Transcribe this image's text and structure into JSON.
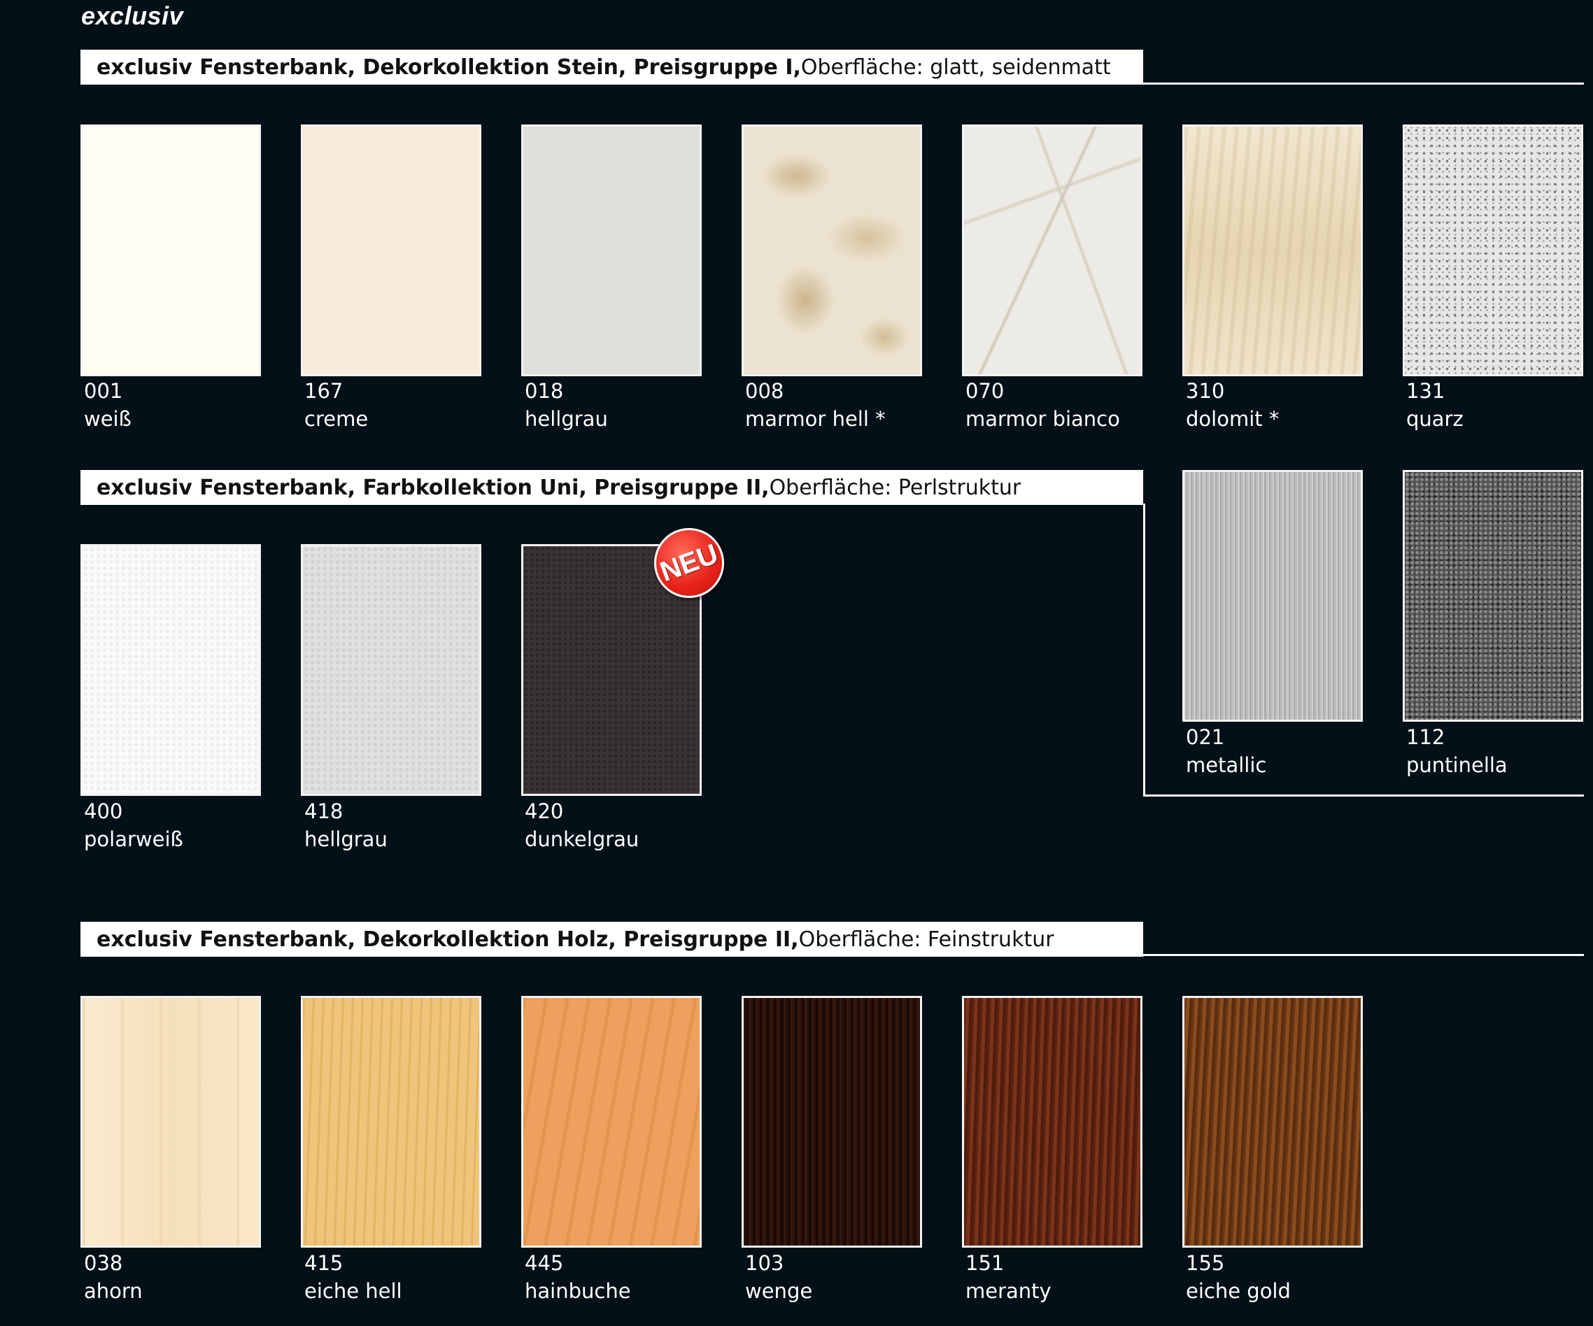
{
  "logo": "exclusiv",
  "sections": [
    {
      "header_bold": "exclusiv Fensterbank, Dekorkollektion Stein, Preisgruppe I,",
      "header_regular": " Oberfläche: glatt, seidenmatt",
      "items": [
        {
          "code": "001",
          "name": "weiß"
        },
        {
          "code": "167",
          "name": "creme"
        },
        {
          "code": "018",
          "name": "hellgrau"
        },
        {
          "code": "008",
          "name": "marmor hell *"
        },
        {
          "code": "070",
          "name": "marmor bianco"
        },
        {
          "code": "310",
          "name": "dolomit *"
        },
        {
          "code": "131",
          "name": "quarz"
        }
      ]
    },
    {
      "header_bold": "exclusiv Fensterbank, Farbkollektion Uni, Preisgruppe II,",
      "header_regular": " Oberfläche: Perlstruktur",
      "items": [
        {
          "code": "400",
          "name": "polarweiß"
        },
        {
          "code": "418",
          "name": "hellgrau"
        },
        {
          "code": "420",
          "name": "dunkelgrau"
        },
        {
          "code": "021",
          "name": "metallic"
        },
        {
          "code": "112",
          "name": "puntinella"
        }
      ],
      "badge": "NEU"
    },
    {
      "header_bold": "exclusiv Fensterbank, Dekorkollektion Holz, Preisgruppe II,",
      "header_regular": " Oberfläche: Feinstruktur",
      "items": [
        {
          "code": "038",
          "name": "ahorn"
        },
        {
          "code": "415",
          "name": "eiche hell"
        },
        {
          "code": "445",
          "name": "hainbuche"
        },
        {
          "code": "103",
          "name": "wenge"
        },
        {
          "code": "151",
          "name": "meranty"
        },
        {
          "code": "155",
          "name": "eiche gold"
        }
      ]
    }
  ]
}
